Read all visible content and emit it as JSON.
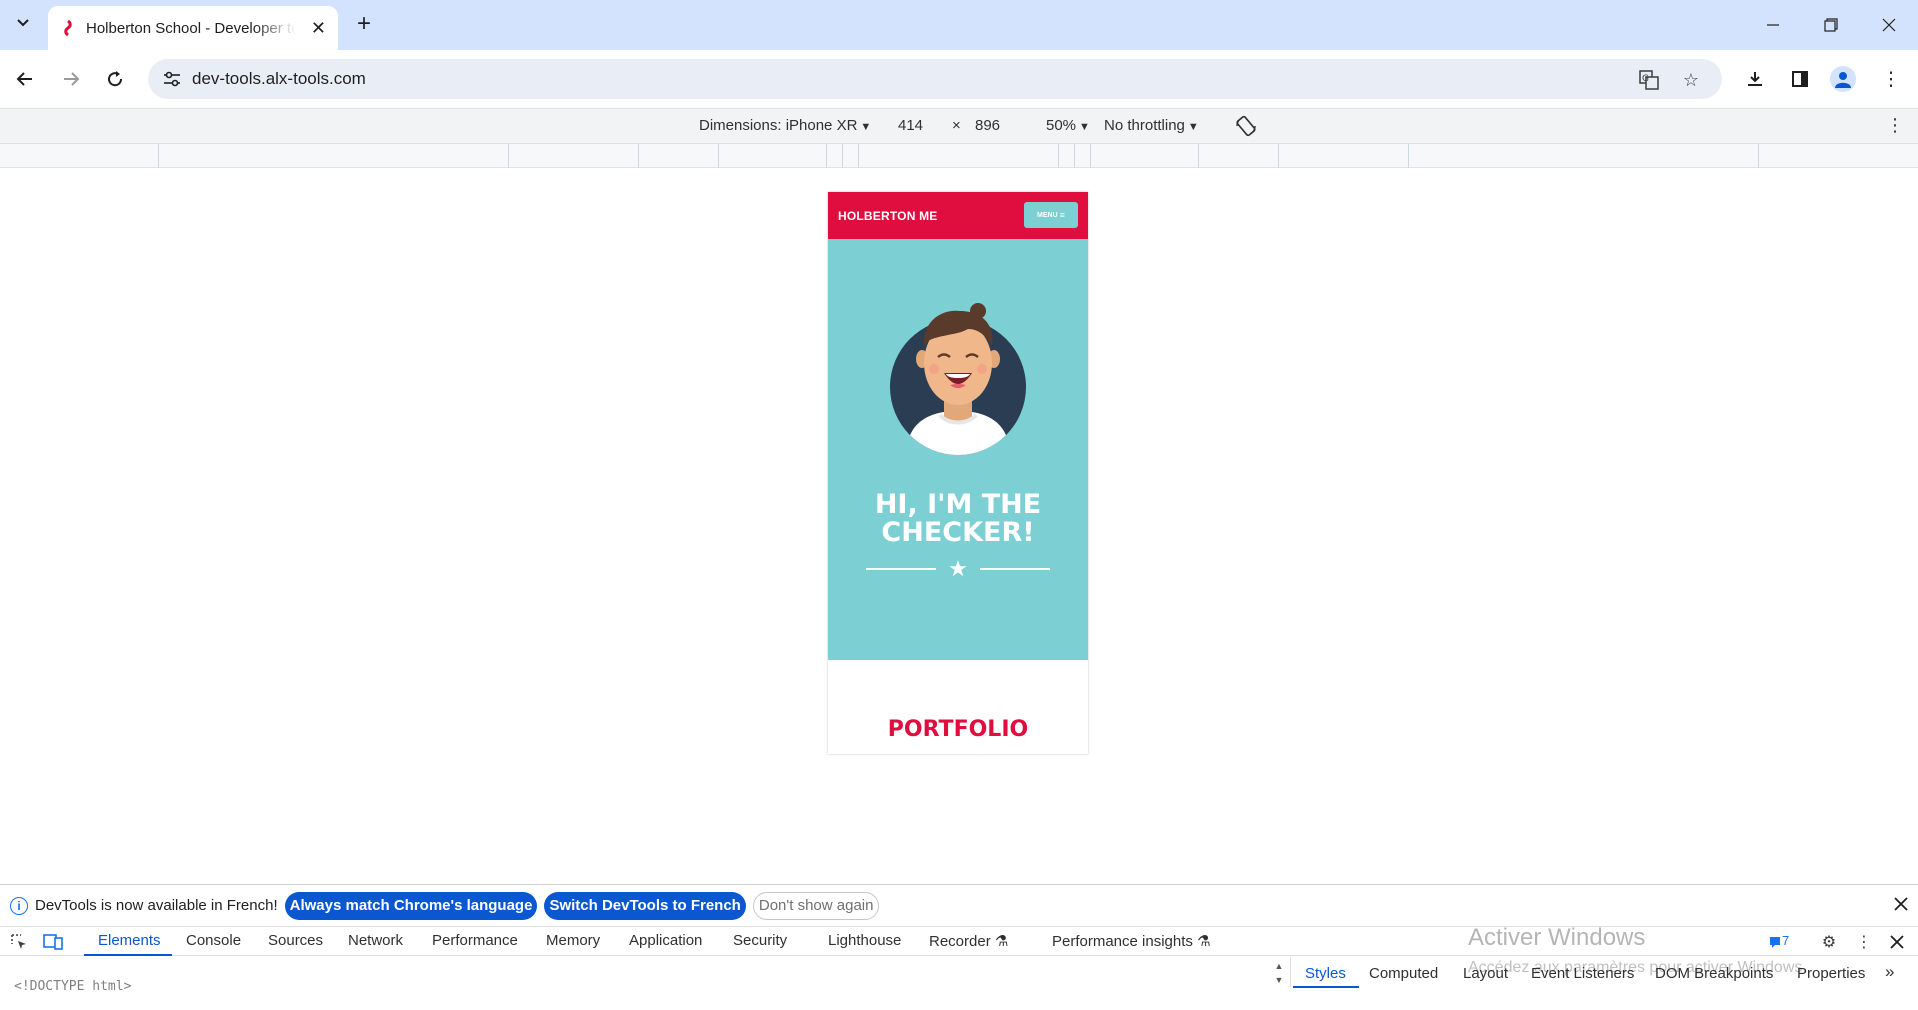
{
  "browser": {
    "tab_title": "Holberton School - Developer tools",
    "url": "dev-tools.alx-tools.com",
    "new_tab": "+",
    "tab_close": "✕"
  },
  "device_toolbar": {
    "dimensions_label": "Dimensions: iPhone XR",
    "width": "414",
    "times": "×",
    "height": "896",
    "zoom": "50%",
    "throttling": "No throttling"
  },
  "site": {
    "brand": "HOLBERTON ME",
    "menu": "MENU",
    "menu_icon": "≡",
    "hero_title_line1": "HI, I'M THE",
    "hero_title_line2": "CHECKER!",
    "section_title": "PORTFOLIO",
    "colors": {
      "brand": "#e00e3f",
      "hero": "#7ccfd3"
    }
  },
  "devtools": {
    "info_message": "DevTools is now available in French!",
    "btn_match": "Always match Chrome's language",
    "btn_switch": "Switch DevTools to French",
    "btn_dismiss": "Don't show again",
    "tabs": [
      "Elements",
      "Console",
      "Sources",
      "Network",
      "Performance",
      "Memory",
      "Application",
      "Security",
      "Lighthouse",
      "Recorder",
      "Performance insights"
    ],
    "issues_count": "7",
    "doctype": "<!DOCTYPE html>",
    "side_tabs": [
      "Styles",
      "Computed",
      "Layout",
      "Event Listeners",
      "DOM Breakpoints",
      "Properties"
    ],
    "more": "»"
  },
  "os_watermark": {
    "title": "Activer Windows",
    "subtitle": "Accédez aux paramètres pour activer Windows."
  }
}
